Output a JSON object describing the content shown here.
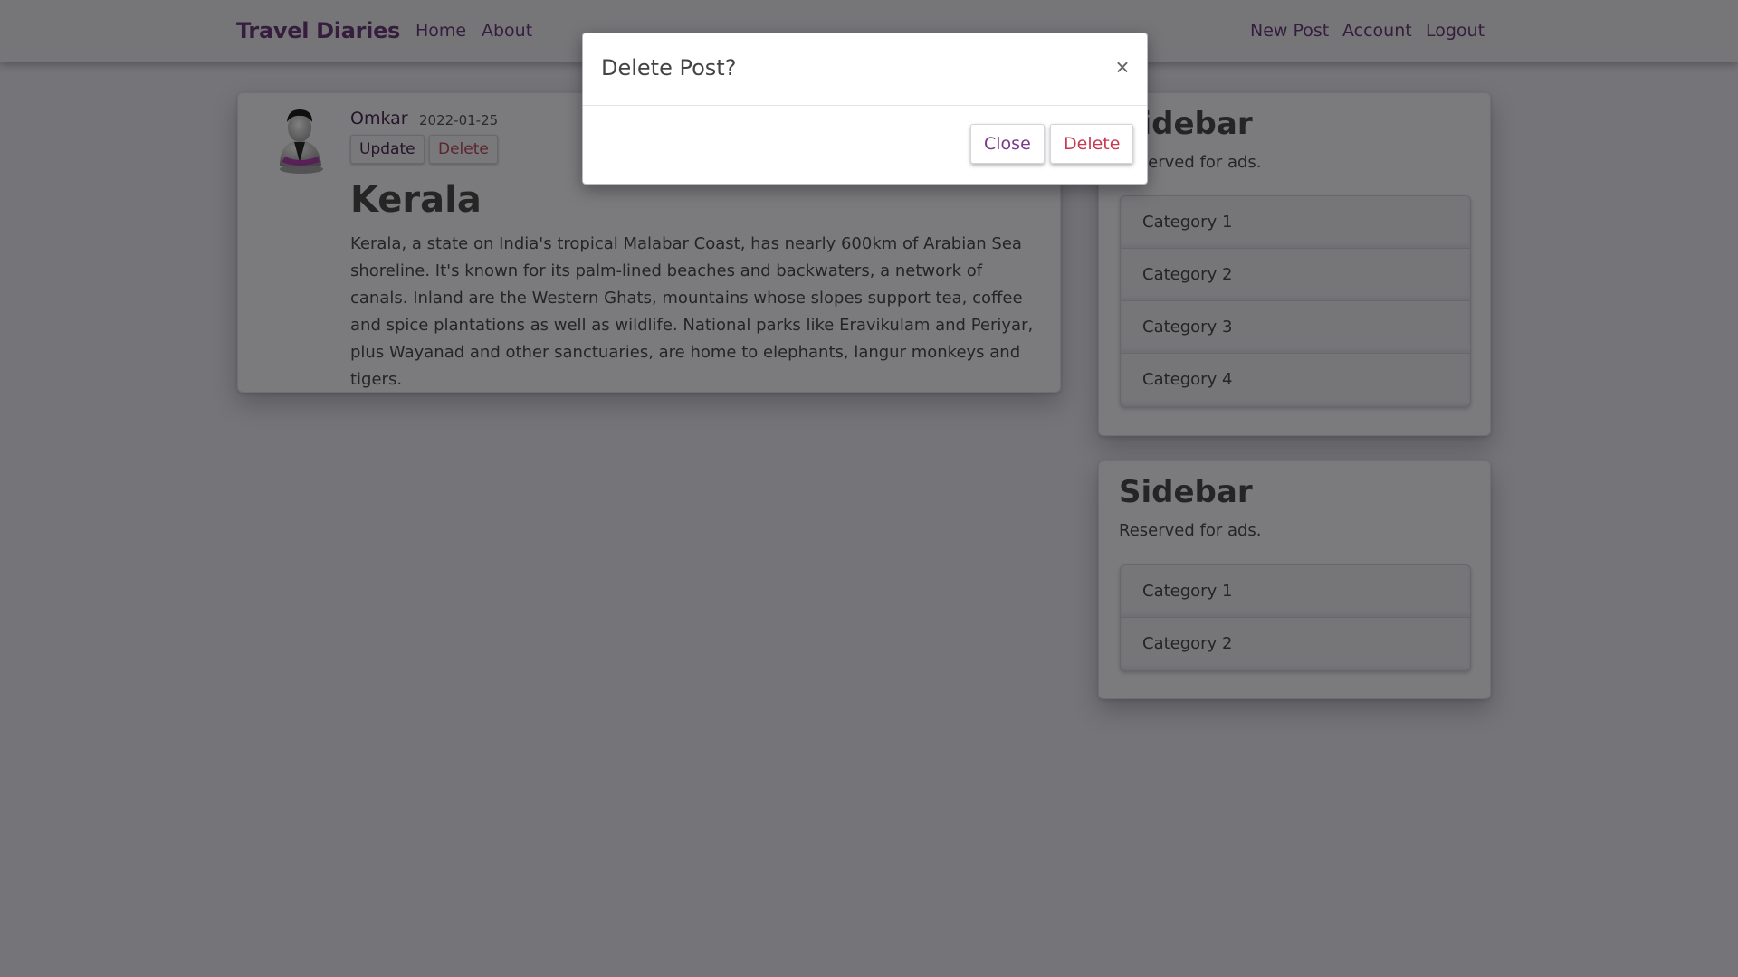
{
  "navbar": {
    "brand": "Travel Diaries",
    "links_left": [
      "Home",
      "About"
    ],
    "links_right": [
      "New Post",
      "Account",
      "Logout"
    ]
  },
  "post": {
    "author": "Omkar",
    "date": "2022-01-25",
    "update_label": "Update",
    "delete_label": "Delete",
    "title": "Kerala",
    "body": "Kerala, a state on India's tropical Malabar Coast, has nearly 600km of Arabian Sea shoreline. It's known for its palm-lined beaches and backwaters, a network of canals. Inland are the Western Ghats, mountains whose slopes support tea, coffee and spice plantations as well as wildlife. National parks like Eravikulam and Periyar, plus Wayanad and other sanctuaries, are home to elephants, langur monkeys and tigers."
  },
  "sidebar1": {
    "title": "Sidebar",
    "text": "Reserved for ads.",
    "items": [
      "Category 1",
      "Category 2",
      "Category 3",
      "Category 4"
    ]
  },
  "sidebar2": {
    "title": "Sidebar",
    "text": "Reserved for ads.",
    "items": [
      "Category 1",
      "Category 2"
    ]
  },
  "modal": {
    "title": "Delete Post?",
    "close_symbol": "×",
    "close_label": "Close",
    "delete_label": "Delete"
  },
  "colors": {
    "accent": "#6b3d7a",
    "danger": "#c73a52",
    "background": "#e9e8f2"
  },
  "icons": {
    "avatar": "user-avatar-icon",
    "modal_close": "close-icon"
  }
}
